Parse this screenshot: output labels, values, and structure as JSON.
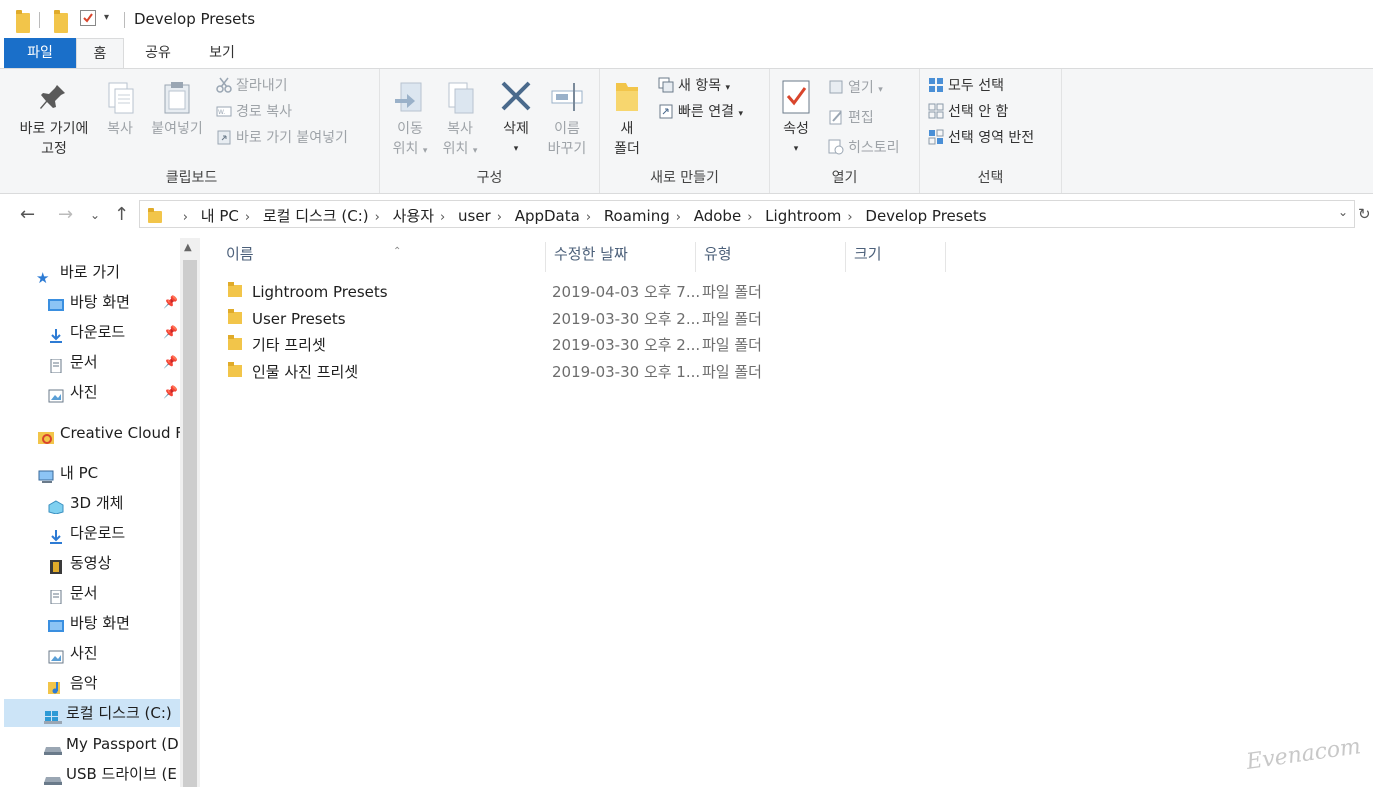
{
  "window": {
    "title": "Develop Presets"
  },
  "tabs": [
    {
      "label": "파일"
    },
    {
      "label": "홈"
    },
    {
      "label": "공유"
    },
    {
      "label": "보기"
    }
  ],
  "ribbon": {
    "clipboard": {
      "label": "클립보드",
      "pin_label_1": "바로 가기에",
      "pin_label_2": "고정",
      "copy": "복사",
      "paste": "붙여넣기",
      "cut": "잘라내기",
      "copy_path": "경로 복사",
      "paste_shortcut": "바로 가기 붙여넣기"
    },
    "organize": {
      "label": "구성",
      "move_to_1": "이동",
      "move_to_2": "위치",
      "copy_to_1": "복사",
      "copy_to_2": "위치",
      "delete": "삭제",
      "rename_1": "이름",
      "rename_2": "바꾸기"
    },
    "new": {
      "label": "새로 만들기",
      "new_folder_1": "새",
      "new_folder_2": "폴더",
      "new_item": "새 항목",
      "easy_access": "빠른 연결"
    },
    "open": {
      "label": "열기",
      "properties": "속성",
      "open": "열기",
      "edit": "편집",
      "history": "히스토리"
    },
    "select": {
      "label": "선택",
      "select_all": "모두 선택",
      "select_none": "선택 안 함",
      "invert": "선택 영역 반전"
    }
  },
  "address": {
    "crumbs": [
      "내 PC",
      "로컬 디스크 (C:)",
      "사용자",
      "user",
      "AppData",
      "Roaming",
      "Adobe",
      "Lightroom",
      "Develop Presets"
    ]
  },
  "nav": {
    "quick_access": "바로 가기",
    "quick_items": [
      {
        "label": "바탕 화면"
      },
      {
        "label": "다운로드"
      },
      {
        "label": "문서"
      },
      {
        "label": "사진"
      }
    ],
    "creative_cloud": "Creative Cloud Fil",
    "this_pc": "내 PC",
    "pc_items": [
      {
        "label": "3D 개체"
      },
      {
        "label": "다운로드"
      },
      {
        "label": "동영상"
      },
      {
        "label": "문서"
      },
      {
        "label": "바탕 화면"
      },
      {
        "label": "사진"
      },
      {
        "label": "음악"
      },
      {
        "label": "로컬 디스크 (C:)"
      },
      {
        "label": "My Passport (D:)"
      },
      {
        "label": "USB 드라이브 (E"
      }
    ]
  },
  "columns": {
    "name": "이름",
    "date": "수정한 날짜",
    "type": "유형",
    "size": "크기"
  },
  "files": [
    {
      "name": "Lightroom Presets",
      "date": "2019-04-03 오후 7...",
      "type": "파일 폴더"
    },
    {
      "name": "User Presets",
      "date": "2019-03-30 오후 2...",
      "type": "파일 폴더"
    },
    {
      "name": "기타 프리셋",
      "date": "2019-03-30 오후 2...",
      "type": "파일 폴더"
    },
    {
      "name": "인물 사진 프리셋",
      "date": "2019-03-30 오후 1...",
      "type": "파일 폴더"
    }
  ],
  "watermark": "Evenacom",
  "colors": {
    "accent": "#1a6fc9",
    "selected": "#cce4f7",
    "folder": "#f2c54a"
  }
}
